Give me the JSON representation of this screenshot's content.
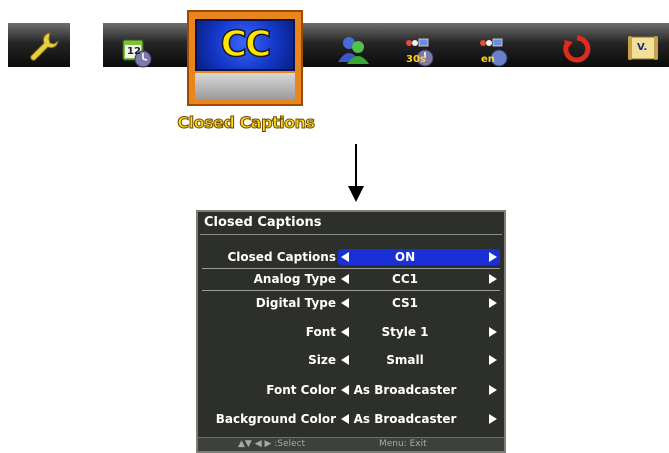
{
  "iconbar": {
    "icons": [
      "wrench-icon",
      "calendar-clock-icon",
      "closed-captions-icon",
      "user-icon",
      "sleep-timer-icon",
      "language-icon",
      "reset-icon",
      "version-icon"
    ],
    "calendar_number": "12",
    "timer_label": "30s",
    "language_label": "en",
    "version_label": "V.",
    "selected_cc_text": "CC",
    "selected_label": "Closed Captions"
  },
  "panel": {
    "title": "Closed Captions",
    "rows": [
      {
        "label": "Closed Captions",
        "value": "ON"
      },
      {
        "label": "Analog Type",
        "value": "CC1"
      },
      {
        "label": "Digital Type",
        "value": "CS1"
      },
      {
        "label": "Font",
        "value": "Style 1"
      },
      {
        "label": "Size",
        "value": "Small"
      },
      {
        "label": "Font Color",
        "value": "As Broadcaster"
      },
      {
        "label": "Background Color",
        "value": "As Broadcaster"
      }
    ],
    "footer_select": "▲▼ ◀ ▶ :Select",
    "footer_exit": "Menu: Exit"
  },
  "colors": {
    "highlight": "#1a2fd6",
    "panel_bg": "#2d2f2b",
    "selected_frame": "#e8851d",
    "label_gold": "#ffd91a"
  }
}
